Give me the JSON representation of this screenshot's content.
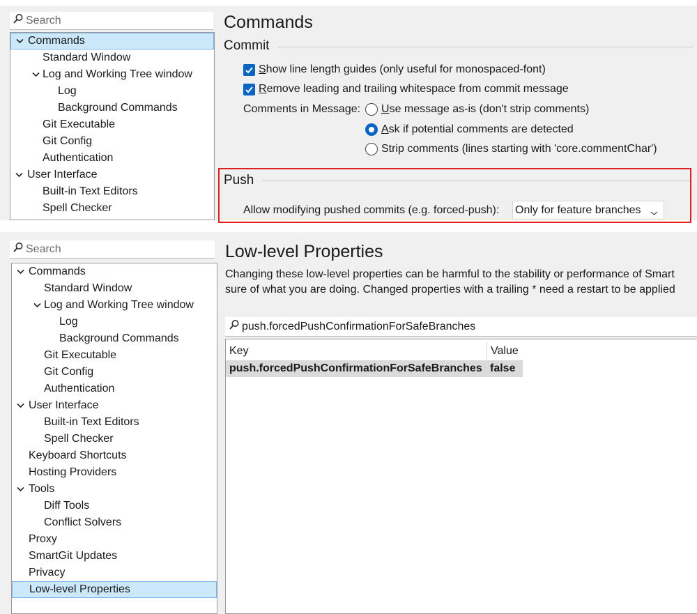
{
  "top": {
    "search": {
      "placeholder": "Search"
    },
    "tree": [
      {
        "label": "Commands",
        "level": 0,
        "expanded": true,
        "selected": true
      },
      {
        "label": "Standard Window",
        "level": 1
      },
      {
        "label": "Log and Working Tree window",
        "level": 1,
        "expanded": true
      },
      {
        "label": "Log",
        "level": 2
      },
      {
        "label": "Background Commands",
        "level": 2
      },
      {
        "label": "Git Executable",
        "level": 1
      },
      {
        "label": "Git Config",
        "level": 1
      },
      {
        "label": "Authentication",
        "level": 1
      },
      {
        "label": "User Interface",
        "level": 0,
        "expanded": true
      },
      {
        "label": "Built-in Text Editors",
        "level": 1
      },
      {
        "label": "Spell Checker",
        "level": 1
      }
    ],
    "title": "Commands",
    "commit": {
      "heading": "Commit",
      "show_guides": {
        "mnemonic": "S",
        "rest": "how line length guides (only useful for monospaced-font)",
        "checked": true
      },
      "remove_ws": {
        "mnemonic": "R",
        "rest": "emove leading and trailing whitespace from commit message",
        "checked": true
      },
      "comments_label": "Comments in Message:",
      "options": [
        {
          "mnemonic": "U",
          "rest": "se message as-is (don't strip comments)",
          "selected": false
        },
        {
          "mnemonic": "A",
          "rest": "sk if potential comments are detected",
          "selected": true
        },
        {
          "mnemonic": "",
          "rest": "Strip comments (lines starting with 'core.commentChar')",
          "selected": false
        }
      ]
    },
    "push": {
      "heading": "Push",
      "allow_label": "Allow modifying pushed commits (e.g. forced-push):",
      "allow_value": "Only for feature branches"
    }
  },
  "bottom": {
    "search": {
      "placeholder": "Search"
    },
    "tree": [
      {
        "label": "Commands",
        "level": 0,
        "expanded": true
      },
      {
        "label": "Standard Window",
        "level": 1
      },
      {
        "label": "Log and Working Tree window",
        "level": 1,
        "expanded": true
      },
      {
        "label": "Log",
        "level": 2
      },
      {
        "label": "Background Commands",
        "level": 2
      },
      {
        "label": "Git Executable",
        "level": 1
      },
      {
        "label": "Git Config",
        "level": 1
      },
      {
        "label": "Authentication",
        "level": 1
      },
      {
        "label": "User Interface",
        "level": 0,
        "expanded": true
      },
      {
        "label": "Built-in Text Editors",
        "level": 1
      },
      {
        "label": "Spell Checker",
        "level": 1
      },
      {
        "label": "Keyboard Shortcuts",
        "level": 0
      },
      {
        "label": "Hosting Providers",
        "level": 0
      },
      {
        "label": "Tools",
        "level": 0,
        "expanded": true
      },
      {
        "label": "Diff Tools",
        "level": 1
      },
      {
        "label": "Conflict Solvers",
        "level": 1
      },
      {
        "label": "Proxy",
        "level": 0
      },
      {
        "label": "SmartGit Updates",
        "level": 0
      },
      {
        "label": "Privacy",
        "level": 0
      },
      {
        "label": "Low-level Properties",
        "level": 0,
        "selected": true
      }
    ],
    "title": "Low-level Properties",
    "description": [
      "Changing these low-level properties can be harmful to the stability or performance of Smart",
      "sure of what you are doing. Changed properties with a trailing * need a restart to be applied"
    ],
    "filter": {
      "value": "push.forcedPushConfirmationForSafeBranches"
    },
    "table": {
      "columns": [
        "Key",
        "Value"
      ],
      "rows": [
        {
          "key": "push.forcedPushConfirmationForSafeBranches",
          "value": "false"
        }
      ]
    }
  },
  "colors": {
    "accent": "#0a64c2",
    "selection_bg": "#cce8fb",
    "highlight_border": "#e02020",
    "panel_bg": "#f0f0f0"
  }
}
